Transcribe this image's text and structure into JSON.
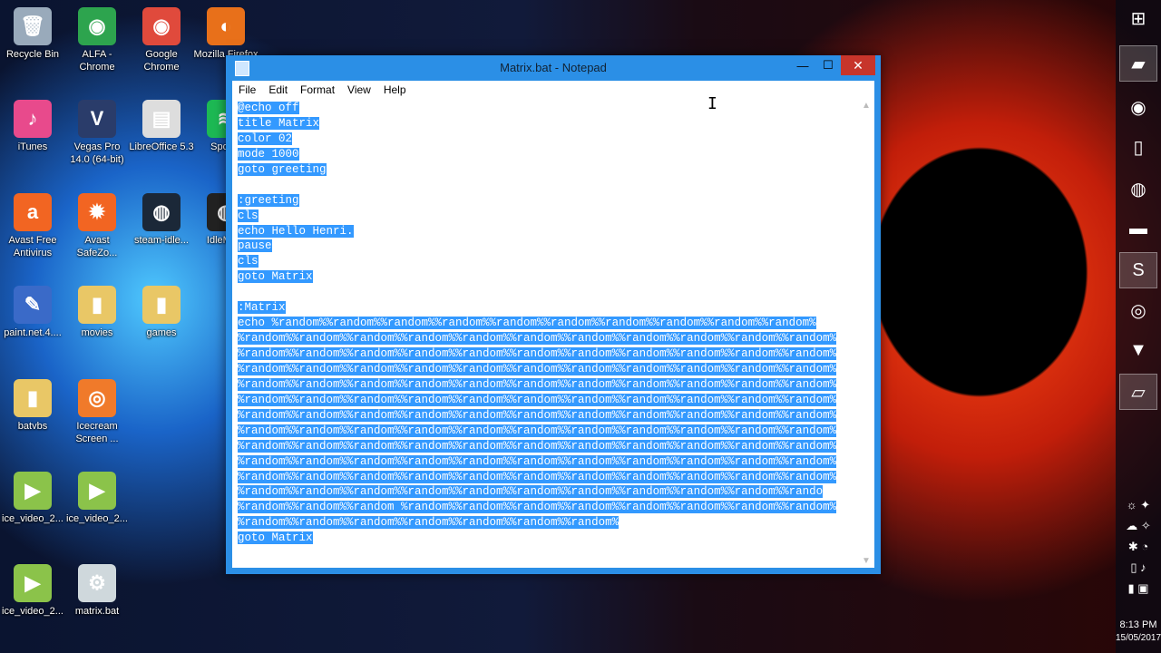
{
  "desktop": {
    "icons": [
      {
        "label": "Recycle Bin",
        "icon": "recycle-bin-icon",
        "glyph": "🗑",
        "color": "#9ab"
      },
      {
        "label": "ALFA - Chrome",
        "icon": "chrome-icon",
        "glyph": "◉",
        "color": "#2da44e"
      },
      {
        "label": "Google Chrome",
        "icon": "chrome-icon",
        "glyph": "◉",
        "color": "#e04a3c"
      },
      {
        "label": "Mozilla Firefox",
        "icon": "firefox-icon",
        "glyph": "◐",
        "color": "#e8701a"
      },
      {
        "label": "iTunes",
        "icon": "itunes-icon",
        "glyph": "♪",
        "color": "#e84a8c"
      },
      {
        "label": "Vegas Pro 14.0 (64-bit)",
        "icon": "vegas-icon",
        "glyph": "V",
        "color": "#2a3c6a"
      },
      {
        "label": "LibreOffice 5.3",
        "icon": "libreoffice-icon",
        "glyph": "▤",
        "color": "#ddd"
      },
      {
        "label": "Spotify",
        "icon": "spotify-icon",
        "glyph": "≋",
        "color": "#1db954"
      },
      {
        "label": "Avast Free Antivirus",
        "icon": "avast-icon",
        "glyph": "a",
        "color": "#f26522"
      },
      {
        "label": "Avast SafeZo...",
        "icon": "avast-safezone-icon",
        "glyph": "✹",
        "color": "#f26522"
      },
      {
        "label": "steam-idle...",
        "icon": "steam-icon",
        "glyph": "◍",
        "color": "#1b2838"
      },
      {
        "label": "IdleMa...",
        "icon": "idle-master-icon",
        "glyph": "◍",
        "color": "#222"
      },
      {
        "label": "paint.net.4....",
        "icon": "paintnet-icon",
        "glyph": "✎",
        "color": "#3a6ac8"
      },
      {
        "label": "movies",
        "icon": "folder-icon",
        "glyph": "▮",
        "color": "#e9c766"
      },
      {
        "label": "games",
        "icon": "folder-icon",
        "glyph": "▮",
        "color": "#e9c766"
      },
      {
        "label": "batvbs",
        "icon": "folder-icon",
        "glyph": "▮",
        "color": "#e9c766"
      },
      {
        "label": "Icecream Screen ...",
        "icon": "icecream-icon",
        "glyph": "◎",
        "color": "#f07a2a"
      },
      {
        "label": "ice_video_2...",
        "icon": "video-play-icon",
        "glyph": "▶",
        "color": "#8bc34a"
      },
      {
        "label": "ice_video_2...",
        "icon": "video-play-icon",
        "glyph": "▶",
        "color": "#8bc34a"
      },
      {
        "label": "ice_video_2...",
        "icon": "video-play-icon",
        "glyph": "▶",
        "color": "#8bc34a"
      },
      {
        "label": "matrix.bat",
        "icon": "batch-file-icon",
        "glyph": "⚙",
        "color": "#cfd8dc"
      }
    ]
  },
  "window": {
    "title": "Matrix.bat - Notepad",
    "min_glyph": "—",
    "max_glyph": "☐",
    "close_glyph": "✕",
    "menu": [
      "File",
      "Edit",
      "Format",
      "View",
      "Help"
    ],
    "lines": [
      "@echo off",
      "title Matrix",
      "color 02",
      "mode 1000",
      "goto greeting",
      "",
      ":greeting",
      "cls",
      "echo Hello Henri.",
      "pause",
      "cls",
      "goto Matrix",
      "",
      ":Matrix",
      "echo %random%%random%%random%%random%%random%%random%%random%%random%%random%%random%",
      "%random%%random%%random%%random%%random%%random%%random%%random%%random%%random%%random%",
      "%random%%random%%random%%random%%random%%random%%random%%random%%random%%random%%random%",
      "%random%%random%%random%%random%%random%%random%%random%%random%%random%%random%%random%",
      "%random%%random%%random%%random%%random%%random%%random%%random%%random%%random%%random%",
      "%random%%random%%random%%random%%random%%random%%random%%random%%random%%random%%random%",
      "%random%%random%%random%%random%%random%%random%%random%%random%%random%%random%%random%",
      "%random%%random%%random%%random%%random%%random%%random%%random%%random%%random%%random%",
      "%random%%random%%random%%random%%random%%random%%random%%random%%random%%random%%random%",
      "%random%%random%%random%%random%%random%%random%%random%%random%%random%%random%%random%",
      "%random%%random%%random%%random%%random%%random%%random%%random%%random%%random%%random%",
      "%random%%random%%random%%random%%random%%random%%random%%random%%random%%random%%rando",
      "%random%%random%%random %random%%random%%random%%random%%random%%random%%random%%random%",
      "%random%%random%%random%%random%%random%%random%%random%",
      "goto Matrix"
    ]
  },
  "taskbar": {
    "items": [
      {
        "name": "windows-start-icon",
        "glyph": "⊞",
        "active": false
      },
      {
        "name": "file-explorer-icon",
        "glyph": "▰",
        "active": true
      },
      {
        "name": "chrome-icon",
        "glyph": "◉",
        "active": false
      },
      {
        "name": "document-icon",
        "glyph": "▯",
        "active": false
      },
      {
        "name": "steam-icon",
        "glyph": "◍",
        "active": false
      },
      {
        "name": "cmd-icon",
        "glyph": "▬",
        "active": false
      },
      {
        "name": "skype-icon",
        "glyph": "S",
        "active": true
      },
      {
        "name": "icecream-icon",
        "glyph": "◎",
        "active": false
      },
      {
        "name": "vegas-icon",
        "glyph": "▼",
        "active": false
      },
      {
        "name": "notepad-icon",
        "glyph": "▱",
        "active": true
      }
    ],
    "time": "8:13 PM",
    "date": "15/05/2017"
  }
}
